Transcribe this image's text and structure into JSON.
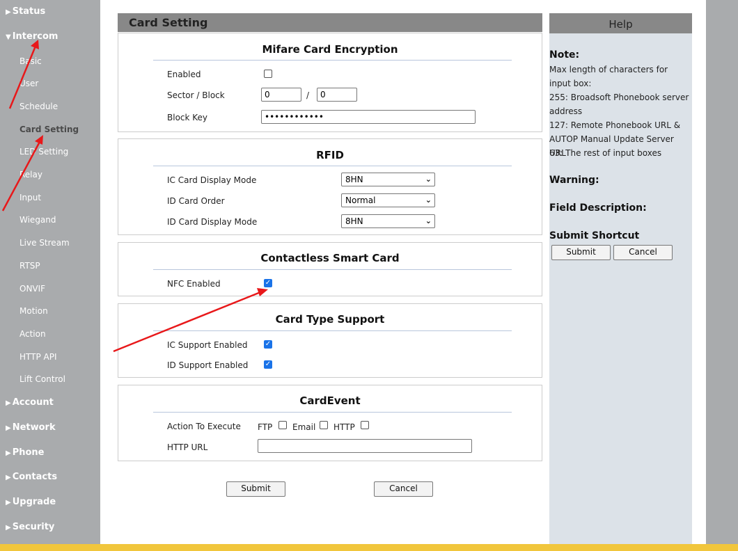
{
  "sidebar": {
    "groups": {
      "status": "Status",
      "intercom": "Intercom",
      "account": "Account",
      "network": "Network",
      "phone": "Phone",
      "contacts": "Contacts",
      "upgrade": "Upgrade",
      "security": "Security"
    },
    "intercom_items": [
      "Basic",
      "User",
      "Schedule",
      "Card Setting",
      "LED Setting",
      "Relay",
      "Input",
      "Wiegand",
      "Live Stream",
      "RTSP",
      "ONVIF",
      "Motion",
      "Action",
      "HTTP API",
      "Lift Control"
    ],
    "active_item": "Card Setting"
  },
  "page": {
    "title": "Card Setting"
  },
  "mifare": {
    "title": "Mifare Card Encryption",
    "enabled_label": "Enabled",
    "enabled": false,
    "sector_label": "Sector / Block",
    "sector_value": "0",
    "separator": "/",
    "block_value": "0",
    "key_label": "Block Key",
    "key_value": "••••••••••••"
  },
  "rfid": {
    "title": "RFID",
    "ic_mode_label": "IC Card Display Mode",
    "ic_mode_value": "8HN",
    "id_order_label": "ID Card Order",
    "id_order_value": "Normal",
    "id_mode_label": "ID Card Display Mode",
    "id_mode_value": "8HN"
  },
  "contactless": {
    "title": "Contactless Smart Card",
    "nfc_label": "NFC Enabled",
    "nfc_enabled": true
  },
  "card_type": {
    "title": "Card Type Support",
    "ic_label": "IC Support Enabled",
    "ic_enabled": true,
    "id_label": "ID Support Enabled",
    "id_enabled": true
  },
  "card_event": {
    "title": "CardEvent",
    "action_label": "Action To Execute",
    "ftp_label": "FTP",
    "email_label": "Email",
    "http_label": "HTTP",
    "url_label": "HTTP URL",
    "url_value": ""
  },
  "footer": {
    "submit": "Submit",
    "cancel": "Cancel"
  },
  "help": {
    "title": "Help",
    "note_heading": "Note:",
    "note_lines": [
      "Max length of characters for input box:",
      "255: Broadsoft Phonebook server address",
      "127: Remote Phonebook URL & AUTOP Manual Update Server URL",
      "63: The rest of input boxes"
    ],
    "warning_heading": "Warning:",
    "field_heading": "Field Description:",
    "shortcut_heading": "Submit Shortcut",
    "submit": "Submit",
    "cancel": "Cancel"
  },
  "colors": {
    "sidebar_bg": "#a9abad",
    "header_bg": "#888888",
    "help_bg": "#dce2e8",
    "bottom_bar": "#f1c63c",
    "arrow": "#e8181a",
    "checkbox_checked": "#1a73e8"
  }
}
